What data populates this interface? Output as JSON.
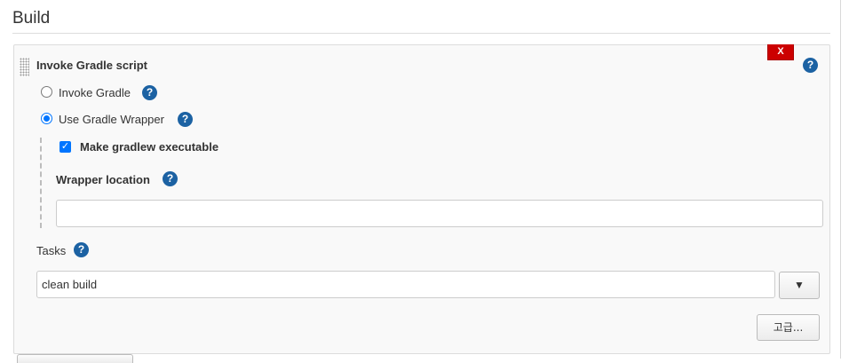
{
  "section": {
    "title": "Build"
  },
  "step": {
    "title": "Invoke Gradle script",
    "delete_label": "X",
    "help_glyph": "?",
    "options": [
      {
        "label": "Invoke Gradle",
        "selected": false
      },
      {
        "label": "Use Gradle Wrapper",
        "selected": true
      }
    ],
    "make_executable": {
      "label": "Make gradlew executable",
      "checked": true
    },
    "wrapper_location": {
      "label": "Wrapper location",
      "value": ""
    },
    "tasks": {
      "label": "Tasks",
      "value": "clean build",
      "dropdown_glyph": "▼"
    },
    "advanced_label": "고급..."
  },
  "colors": {
    "help_icon": "#1c62a3",
    "delete_button": "#cc0000",
    "control_accent": "#0075ff"
  }
}
